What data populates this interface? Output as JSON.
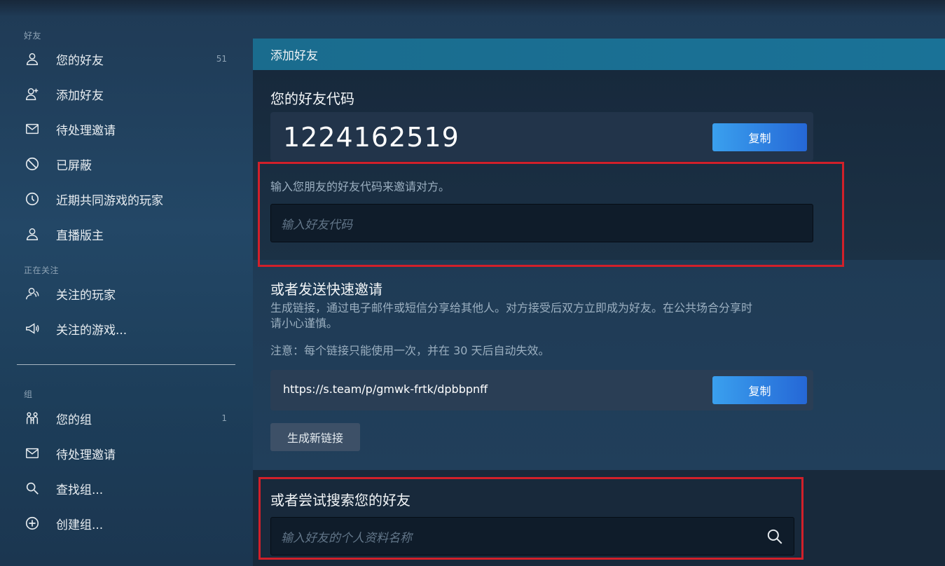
{
  "sidebar": {
    "friends_title": "好友",
    "following_title": "正在关注",
    "groups_title": "组",
    "friends_items": [
      {
        "label": "您的好友",
        "count": "51",
        "icon": "user-icon"
      },
      {
        "label": "添加好友",
        "count": "",
        "icon": "user-plus-icon"
      },
      {
        "label": "待处理邀请",
        "count": "",
        "icon": "envelope-icon"
      },
      {
        "label": "已屏蔽",
        "count": "",
        "icon": "block-icon"
      },
      {
        "label": "近期共同游戏的玩家",
        "count": "",
        "icon": "clock-icon"
      },
      {
        "label": "直播版主",
        "count": "",
        "icon": "user-icon"
      }
    ],
    "following_items": [
      {
        "label": "关注的玩家",
        "count": "",
        "icon": "user-followed-icon"
      },
      {
        "label": "关注的游戏...",
        "count": "",
        "icon": "megaphone-icon"
      }
    ],
    "group_items": [
      {
        "label": "您的组",
        "count": "1",
        "icon": "group-icon"
      },
      {
        "label": "待处理邀请",
        "count": "",
        "icon": "envelope-icon"
      },
      {
        "label": "查找组...",
        "count": "",
        "icon": "search-icon"
      },
      {
        "label": "创建组...",
        "count": "",
        "icon": "plus-circle-icon"
      }
    ]
  },
  "main": {
    "header_title": "添加好友",
    "friend_code_title": "您的好友代码",
    "friend_code": "1224162519",
    "copy_label": "复制",
    "invite_hint": "输入您朋友的好友代码来邀请对方。",
    "friend_code_placeholder": "输入好友代码",
    "quick_invite_title": "或者发送快速邀请",
    "quick_invite_desc_line1": "生成链接，通过电子邮件或短信分享给其他人。对方接受后双方立即成为好友。在公共场合分享时",
    "quick_invite_desc_line2": "请小心谨慎。",
    "quick_invite_note": "注意：每个链接只能使用一次，并在 30 天后自动失效。",
    "invite_link": "https://s.team/p/gmwk-frtk/dpbbpnff",
    "generate_link_label": "生成新链接",
    "search_title": "或者尝试搜索您的好友",
    "search_placeholder": "输入好友的个人资料名称"
  },
  "colors": {
    "accent_blue": "#2f86e4",
    "header_teal": "#1a6c8e",
    "highlight_red": "#d1202a"
  }
}
